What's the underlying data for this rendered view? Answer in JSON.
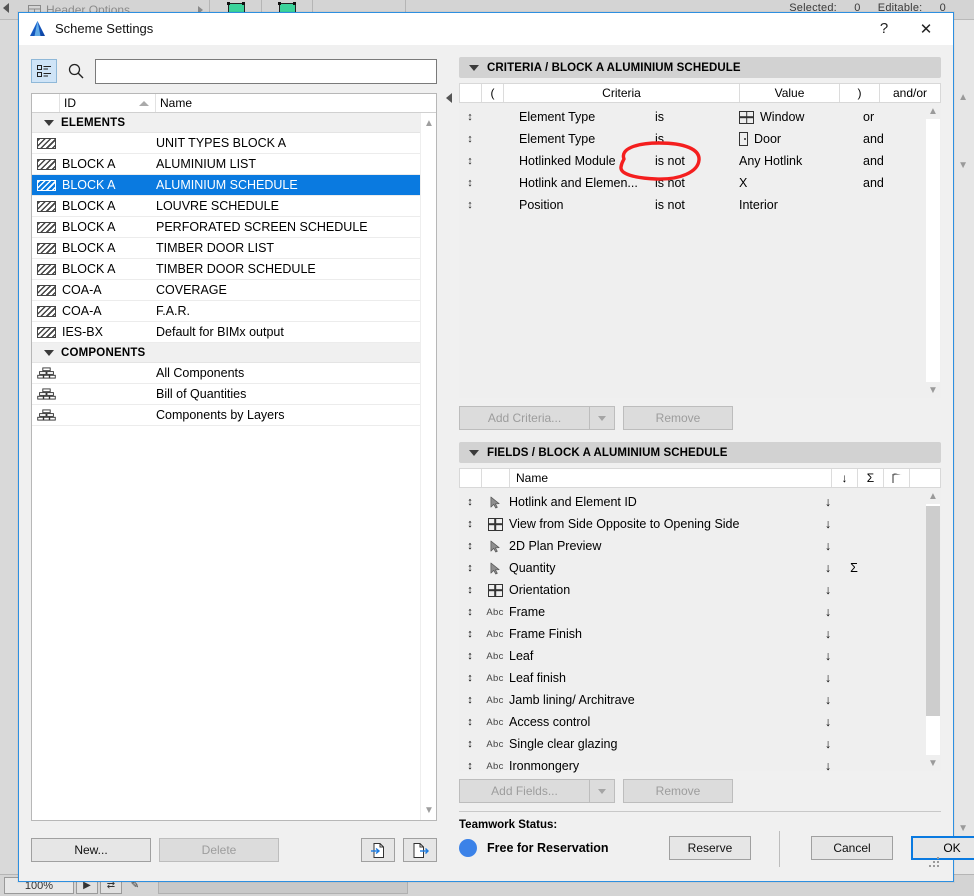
{
  "background": {
    "toolbar": {
      "header_options_label": "Header Options",
      "header_options_icon": "table-header-icon",
      "expand_arrow_icon": "triangle-right-icon",
      "tool_icons": [
        "green-element-icon",
        "green-element-node-icon"
      ]
    },
    "status": {
      "selected_label": "Selected:",
      "selected_value": "0",
      "editable_label": "Editable:",
      "editable_value": "0"
    },
    "bottombar": {
      "zoom_value": "100%",
      "arrow_icon": "cursor-arrow-icon",
      "fit_icon": "fit-window-icon",
      "pen_icon": "pen-icon"
    }
  },
  "dialog": {
    "title": "Scheme Settings",
    "app_icon": "archicad-logo-icon",
    "help_label": "?",
    "close_label": "✕"
  },
  "left": {
    "view_toggle_icon": "list-view-icon",
    "search_icon": "search-icon",
    "search": {
      "value": "",
      "placeholder": ""
    },
    "columns": {
      "id": "ID",
      "name": "Name",
      "sort_icon": "sort-ascending-icon"
    },
    "groups": [
      {
        "label": "ELEMENTS",
        "icon": "schedule-hatch-icon",
        "items": [
          {
            "id": "",
            "name": "UNIT TYPES BLOCK A",
            "selected": false
          },
          {
            "id": "BLOCK A",
            "name": "ALUMINIUM LIST",
            "selected": false
          },
          {
            "id": "BLOCK A",
            "name": "ALUMINIUM SCHEDULE",
            "selected": true
          },
          {
            "id": "BLOCK A",
            "name": "LOUVRE SCHEDULE",
            "selected": false
          },
          {
            "id": "BLOCK A",
            "name": "PERFORATED SCREEN SCHEDULE",
            "selected": false
          },
          {
            "id": "BLOCK A",
            "name": "TIMBER DOOR LIST",
            "selected": false
          },
          {
            "id": "BLOCK A",
            "name": "TIMBER DOOR SCHEDULE",
            "selected": false
          },
          {
            "id": "COA-A",
            "name": "COVERAGE",
            "selected": false
          },
          {
            "id": "COA-A",
            "name": "F.A.R.",
            "selected": false
          },
          {
            "id": "IES-BX",
            "name": "Default for BIMx output",
            "selected": false
          }
        ]
      },
      {
        "label": "COMPONENTS",
        "icon": "components-brick-icon",
        "items": [
          {
            "id": "",
            "name": "All Components",
            "selected": false
          },
          {
            "id": "",
            "name": "Bill of Quantities",
            "selected": false
          },
          {
            "id": "",
            "name": "Components by Layers",
            "selected": false
          }
        ]
      }
    ],
    "buttons": {
      "new": "New...",
      "delete": "Delete",
      "import_icon": "import-file-icon",
      "export_icon": "export-file-icon"
    }
  },
  "criteria": {
    "section_title": "CRITERIA / BLOCK A ALUMINIUM SCHEDULE",
    "collapse_icon": "caret-down-icon",
    "columns": {
      "handle": "",
      "open_paren": "(",
      "criteria": "Criteria",
      "value": "Value",
      "close_paren": ")",
      "andor": "and/or"
    },
    "rows": [
      {
        "handle_icon": "drag-handle-icon",
        "paren": "",
        "criteria": "Element Type",
        "operator": "is",
        "value_icon": "window-icon",
        "value": "Window",
        "paren2": "",
        "andor": "or"
      },
      {
        "handle_icon": "drag-handle-icon",
        "paren": "",
        "criteria": "Element Type",
        "operator": "is",
        "value_icon": "door-icon",
        "value": "Door",
        "paren2": "",
        "andor": "and"
      },
      {
        "handle_icon": "drag-handle-icon",
        "paren": "",
        "criteria": "Hotlinked Module",
        "operator": "is not",
        "value_icon": "",
        "value": "Any Hotlink",
        "paren2": "",
        "andor": "and"
      },
      {
        "handle_icon": "drag-handle-icon",
        "paren": "",
        "criteria": "Hotlink and Elemen...",
        "operator": "is not",
        "value_icon": "",
        "value": "X",
        "paren2": "",
        "andor": "and"
      },
      {
        "handle_icon": "drag-handle-icon",
        "paren": "",
        "criteria": "Position",
        "operator": "is not",
        "value_icon": "",
        "value": "Interior",
        "paren2": "",
        "andor": ""
      }
    ],
    "buttons": {
      "add": "Add Criteria...",
      "add_dropdown_icon": "caret-down-icon",
      "remove": "Remove"
    },
    "annotation": {
      "shape": "red-circle-annotation",
      "color": "#f41e1e",
      "targets": "is not"
    }
  },
  "fields": {
    "section_title": "FIELDS / BLOCK A ALUMINIUM SCHEDULE",
    "collapse_icon": "caret-down-icon",
    "columns": {
      "name": "Name",
      "sort": "↓",
      "sum": "Σ",
      "flag": "flag-icon"
    },
    "rows": [
      {
        "type_icon": "cursor-arrow-icon",
        "type_label": "",
        "name": "Hotlink and Element ID",
        "sort": "↓",
        "sum": ""
      },
      {
        "type_icon": "window-icon",
        "type_label": "",
        "name": "View from Side Opposite to Opening Side",
        "sort": "↓",
        "sum": ""
      },
      {
        "type_icon": "cursor-arrow-icon",
        "type_label": "",
        "name": "2D Plan Preview",
        "sort": "↓",
        "sum": ""
      },
      {
        "type_icon": "cursor-arrow-icon",
        "type_label": "",
        "name": "Quantity",
        "sort": "↓",
        "sum": "Σ"
      },
      {
        "type_icon": "window-icon",
        "type_label": "",
        "name": "Orientation",
        "sort": "↓",
        "sum": ""
      },
      {
        "type_icon": "abc-text-icon",
        "type_label": "Abc",
        "name": "Frame",
        "sort": "↓",
        "sum": ""
      },
      {
        "type_icon": "abc-text-icon",
        "type_label": "Abc",
        "name": "Frame Finish",
        "sort": "↓",
        "sum": ""
      },
      {
        "type_icon": "abc-text-icon",
        "type_label": "Abc",
        "name": "Leaf",
        "sort": "↓",
        "sum": ""
      },
      {
        "type_icon": "abc-text-icon",
        "type_label": "Abc",
        "name": "Leaf finish",
        "sort": "↓",
        "sum": ""
      },
      {
        "type_icon": "abc-text-icon",
        "type_label": "Abc",
        "name": "Jamb lining/ Architrave",
        "sort": "↓",
        "sum": ""
      },
      {
        "type_icon": "abc-text-icon",
        "type_label": "Abc",
        "name": "Access control",
        "sort": "↓",
        "sum": ""
      },
      {
        "type_icon": "abc-text-icon",
        "type_label": "Abc",
        "name": "Single clear glazing",
        "sort": "↓",
        "sum": ""
      },
      {
        "type_icon": "abc-text-icon",
        "type_label": "Abc",
        "name": "Ironmongery",
        "sort": "↓",
        "sum": ""
      }
    ],
    "buttons": {
      "add": "Add Fields...",
      "add_dropdown_icon": "caret-down-icon",
      "remove": "Remove"
    }
  },
  "teamwork": {
    "label": "Teamwork Status:",
    "status": "Free for Reservation",
    "status_color": "#3b82e8",
    "reserve": "Reserve",
    "cancel": "Cancel",
    "ok": "OK"
  }
}
